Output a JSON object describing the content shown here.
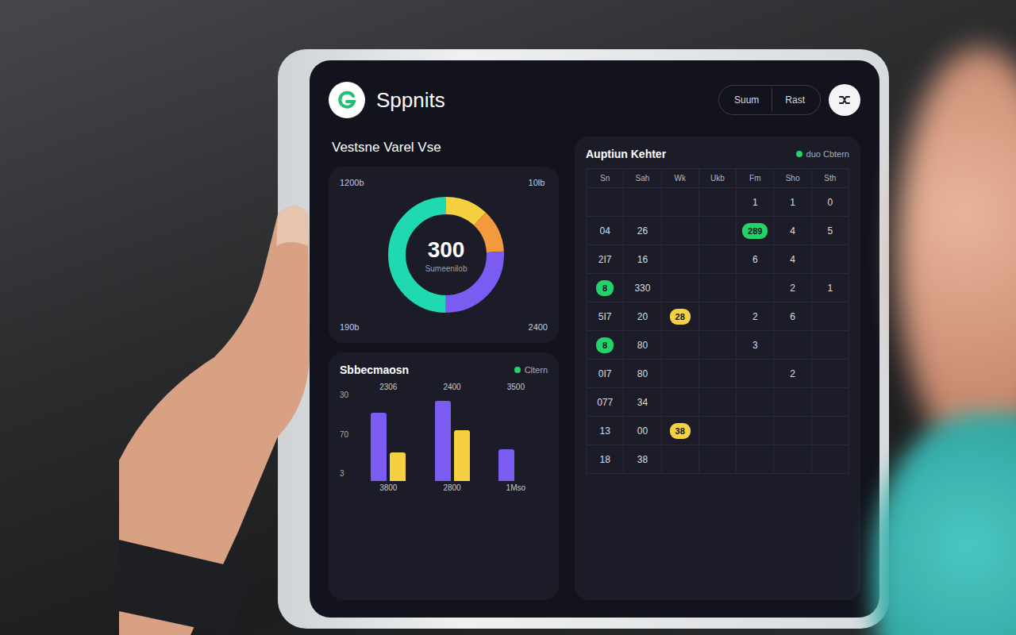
{
  "app": {
    "name": "Sppnits"
  },
  "header": {
    "buttons": [
      {
        "label": "Suum"
      },
      {
        "label": "Rast"
      }
    ]
  },
  "overview": {
    "title": "Vestsne Varel Vse",
    "donut": {
      "value": "300",
      "caption": "Sumeenilob",
      "labels": [
        "1200b",
        "10lb",
        "190b",
        "2400"
      ],
      "segments": [
        {
          "value": 12,
          "color": "#f5d142"
        },
        {
          "value": 12,
          "color": "#f39a3c"
        },
        {
          "value": 26,
          "color": "#7b5cf2"
        },
        {
          "value": 50,
          "color": "#1fd9b0"
        }
      ]
    }
  },
  "bar_chart": {
    "title": "Sbbecmaosn",
    "legend": "Cltern",
    "y_ticks": [
      "30",
      "70",
      "3"
    ],
    "groups": [
      {
        "label": "3800",
        "value_label": "2306"
      },
      {
        "label": "2800",
        "value_label": "2400"
      },
      {
        "label": "1Mso",
        "value_label": "3500"
      }
    ],
    "series": [
      {
        "color": "#7b5cf2",
        "values": [
          78,
          92,
          36
        ]
      },
      {
        "color": "#f5d142",
        "values": [
          33,
          58,
          0
        ]
      }
    ]
  },
  "calendar": {
    "title": "Auptiun Kehter",
    "legend": "duo Cbtern",
    "columns": [
      "Sn",
      "Sah",
      "Wk",
      "Ukb",
      "Fm",
      "Sho",
      "Sth"
    ],
    "rows": [
      [
        {
          "text": ""
        },
        {
          "text": ""
        },
        {
          "text": ""
        },
        {
          "text": ""
        },
        {
          "text": "1"
        },
        {
          "text": "1"
        },
        {
          "text": "0"
        }
      ],
      [
        {
          "text": "04"
        },
        {
          "text": "26"
        },
        {
          "text": ""
        },
        {
          "text": ""
        },
        {
          "text": "289",
          "color": "#22d36a"
        },
        {
          "text": "4"
        },
        {
          "text": "5"
        }
      ],
      [
        {
          "text": "2I7"
        },
        {
          "text": "16"
        },
        {
          "text": ""
        },
        {
          "text": ""
        },
        {
          "text": "6"
        },
        {
          "text": "4"
        },
        {
          "text": ""
        }
      ],
      [
        {
          "text": "8",
          "color": "#22d36a"
        },
        {
          "text": "330"
        },
        {
          "text": ""
        },
        {
          "text": ""
        },
        {
          "text": ""
        },
        {
          "text": "2"
        },
        {
          "text": "1"
        }
      ],
      [
        {
          "text": "5I7"
        },
        {
          "text": "20"
        },
        {
          "text": "28",
          "color": "#f5d142"
        },
        {
          "text": ""
        },
        {
          "text": "2"
        },
        {
          "text": "6"
        },
        {
          "text": ""
        }
      ],
      [
        {
          "text": "8",
          "color": "#22d36a"
        },
        {
          "text": "80"
        },
        {
          "text": ""
        },
        {
          "text": ""
        },
        {
          "text": "3"
        },
        {
          "text": ""
        },
        {
          "text": ""
        }
      ],
      [
        {
          "text": "0I7"
        },
        {
          "text": "80"
        },
        {
          "text": ""
        },
        {
          "text": ""
        },
        {
          "text": ""
        },
        {
          "text": "2"
        },
        {
          "text": ""
        }
      ],
      [
        {
          "text": "077"
        },
        {
          "text": "34"
        },
        {
          "text": ""
        },
        {
          "text": ""
        },
        {
          "text": ""
        },
        {
          "text": ""
        },
        {
          "text": ""
        }
      ],
      [
        {
          "text": "13"
        },
        {
          "text": "00"
        },
        {
          "text": "38",
          "color": "#f5d142"
        },
        {
          "text": ""
        },
        {
          "text": ""
        },
        {
          "text": ""
        },
        {
          "text": ""
        }
      ],
      [
        {
          "text": "18"
        },
        {
          "text": "38"
        },
        {
          "text": ""
        },
        {
          "text": ""
        },
        {
          "text": ""
        },
        {
          "text": ""
        },
        {
          "text": ""
        }
      ]
    ]
  }
}
